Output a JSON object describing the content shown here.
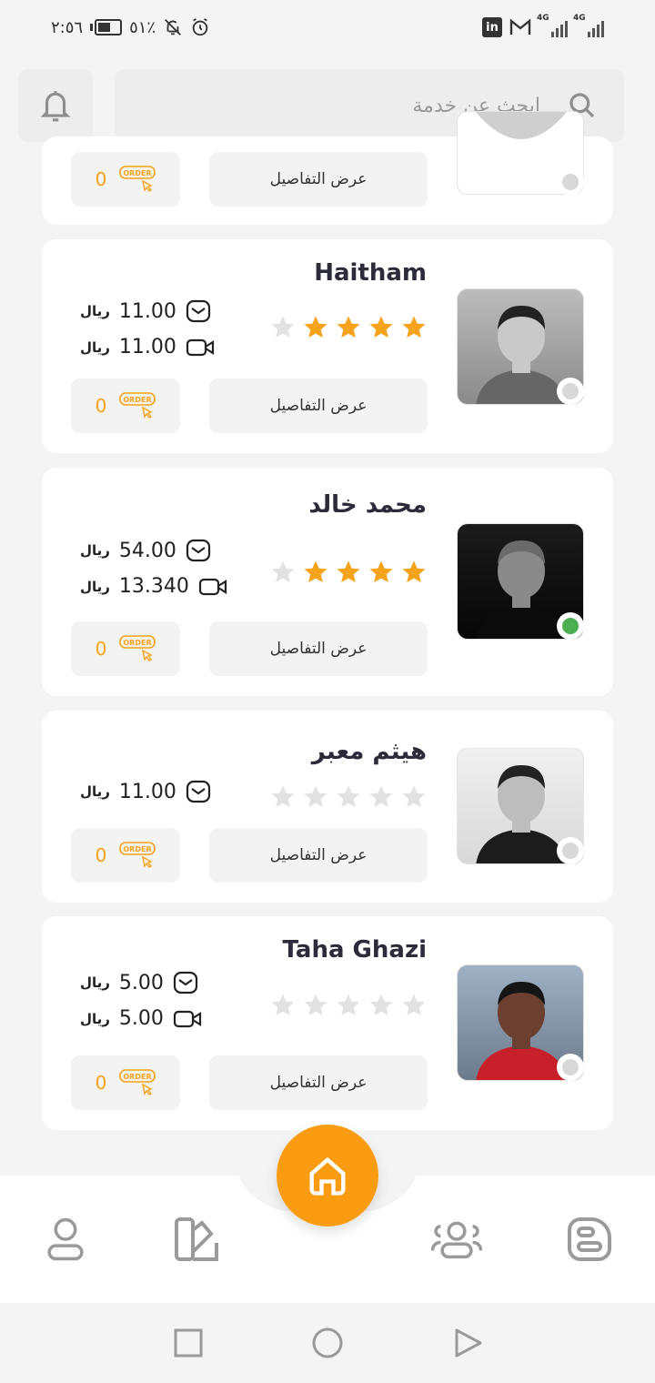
{
  "status_bar": {
    "time": "٢:٥٦",
    "battery": "٥١٪",
    "network_1": "4G",
    "network_2": "4G"
  },
  "search": {
    "placeholder": "ابحث عن خدمة"
  },
  "common": {
    "details_label": "عرض التفاصيل",
    "currency": "ريال",
    "order_badge": "ORDER"
  },
  "partial_card": {
    "order_count": "0"
  },
  "providers": [
    {
      "name": "Haitham",
      "rating": 4,
      "message_price": "11.00",
      "video_price": "11.00",
      "order_count": "0",
      "online": false
    },
    {
      "name": "محمد خالد",
      "rating": 4,
      "message_price": "54.00",
      "video_price": "13.340",
      "order_count": "0",
      "online": true
    },
    {
      "name": "هيثم معبر",
      "rating": 0,
      "message_price": "11.00",
      "video_price": "",
      "order_count": "0",
      "online": false
    },
    {
      "name": "Taha Ghazi",
      "rating": 0,
      "message_price": "5.00",
      "video_price": "5.00",
      "order_count": "0",
      "online": false
    }
  ],
  "bottom_nav": {
    "items": [
      "profile-icon",
      "services-icon",
      "home-icon",
      "users-icon",
      "blog-icon"
    ],
    "accent": "#fa9c12"
  },
  "colors": {
    "accent": "#fa9c12",
    "star_filled": "#f5a31a",
    "star_empty": "#e2e2e2",
    "online": "#4caf50"
  }
}
